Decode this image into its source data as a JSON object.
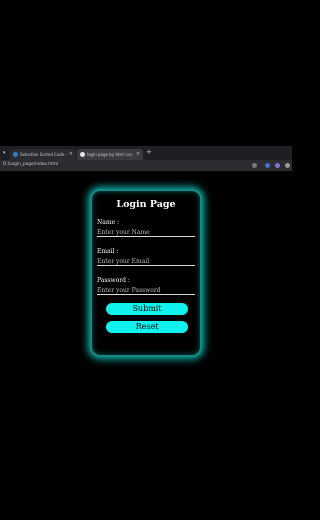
{
  "browser": {
    "tabs": [
      {
        "title": "Selection Sorted Code - Interp",
        "favicon_color": "#2f7fd9"
      },
      {
        "title": "login page by html css - Goog",
        "favicon_color": "#e6e6e6"
      }
    ],
    "new_tab": "+",
    "close_glyph": "×",
    "url": "D:/Login_page/index.html"
  },
  "login": {
    "title": "Login Page",
    "name_label": "Name :",
    "name_placeholder": "Enter your Name",
    "email_label": "Email :",
    "email_placeholder": "Enter your Email",
    "password_label": "Password :",
    "password_placeholder": "Enter your Password",
    "submit_label": "Submit",
    "reset_label": "Reset"
  },
  "colors": {
    "accent": "#0ff2ee",
    "glow": "#10b8b0",
    "background": "#000000"
  }
}
